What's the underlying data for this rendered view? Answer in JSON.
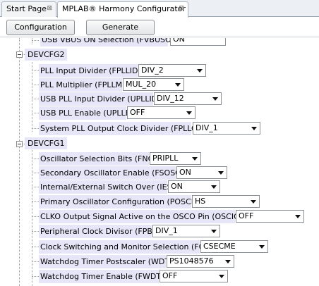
{
  "tabs": [
    {
      "label": "Start Page",
      "close": "⊠"
    },
    {
      "label": "MPLAB® Harmony Configurator",
      "close": "⊠"
    }
  ],
  "toolbar": {
    "configuration_label": "Configuration",
    "generate_label": "Generate"
  },
  "tree": {
    "partial_row": {
      "label": "USB VBUS ON Selection (FVBUSONIO)",
      "value": "ON"
    },
    "devcfg2": {
      "label": "DEVCFG2",
      "rows": [
        {
          "label": "PLL Input Divider (FPLLIDIV)",
          "value": "DIV_2"
        },
        {
          "label": "PLL Multiplier (FPLLMUL)",
          "value": "MUL_20"
        },
        {
          "label": "USB PLL Input Divider (UPLLIDIV)",
          "value": "DIV_12"
        },
        {
          "label": "USB PLL Enable (UPLLEN)",
          "value": "OFF"
        },
        {
          "label": "System PLL Output Clock Divider (FPLLODIV)",
          "value": "DIV_1"
        }
      ]
    },
    "devcfg1": {
      "label": "DEVCFG1",
      "rows": [
        {
          "label": "Oscillator Selection Bits (FNOSC)",
          "value": "PRIPLL"
        },
        {
          "label": "Secondary Oscillator Enable (FSOSCEN)",
          "value": "ON"
        },
        {
          "label": "Internal/External Switch Over (IESO)",
          "value": "ON"
        },
        {
          "label": "Primary Oscillator Configuration (POSCMOD)",
          "value": "HS"
        },
        {
          "label": "CLKO Output Signal Active on the OSCO Pin (OSCIOFNC)",
          "value": "OFF"
        },
        {
          "label": "Peripheral Clock Divisor (FPBDIV)",
          "value": "DIV_1"
        },
        {
          "label": "Clock Switching and Monitor Selection (FCKSM)",
          "value": "CSECME"
        },
        {
          "label": "Watchdog Timer Postscaler (WDTPS)",
          "value": "PS1048576"
        },
        {
          "label": "Watchdog Timer Enable (FWDTEN)",
          "value": "OFF"
        }
      ]
    }
  }
}
